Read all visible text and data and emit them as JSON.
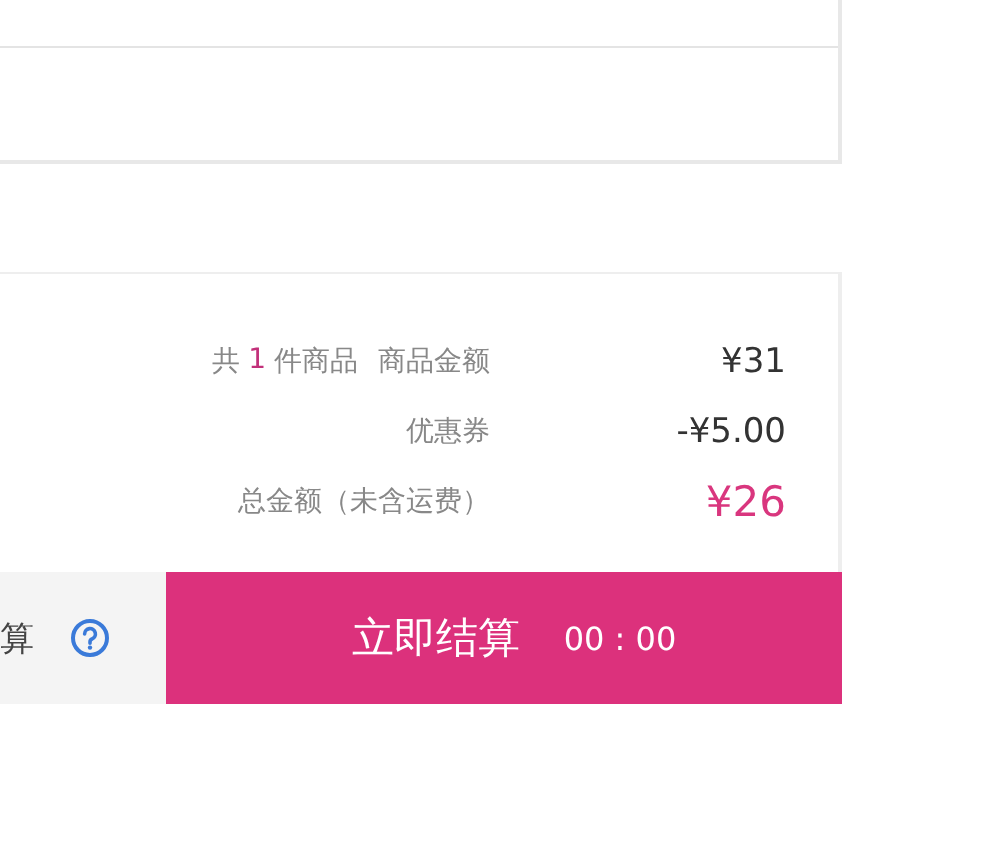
{
  "summary": {
    "count_prefix": "共",
    "count": "1",
    "count_suffix": "件商品",
    "rows": [
      {
        "label": "商品金额",
        "value": "¥31",
        "kind": "plain"
      },
      {
        "label": "优惠券",
        "value": "-¥5.00",
        "kind": "plain"
      },
      {
        "label": "总金额（未含运费）",
        "value": "¥26",
        "kind": "total"
      }
    ]
  },
  "footer": {
    "left_text": "算",
    "checkout_button": "立即结算",
    "timer": "00 : 00"
  }
}
